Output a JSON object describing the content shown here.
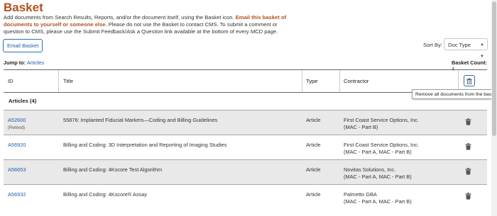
{
  "header": {
    "title": "Basket",
    "intro_part1": "Add documents from Search Results, Reports, and/or the document itself, using the Basket icon. ",
    "intro_emphasis": "Email this basket of documents to yourself or someone else.",
    "intro_part2": " Please do not use the Basket to contact CMS. To submit a comment or question to CMS, please use the Submit Feedback/Ask a Question link available at the bottom of every MCD page."
  },
  "toolbar": {
    "email_label": "Email Basket",
    "sort_label": "Sort By:",
    "sort_value": "Doc Type"
  },
  "jump": {
    "label": "Jump to:",
    "link": "Articles"
  },
  "count": {
    "label": "Basket Count:",
    "value": "4"
  },
  "table": {
    "headers": {
      "id": "ID",
      "title": "Title",
      "type": "Type",
      "contractor": "Contractor"
    },
    "group_label": "Articles (4)",
    "rows": [
      {
        "id": "A52600",
        "sub": "(Retired)",
        "title": "55876: Implanted Fiducial Markers—Coding and Billing Guidelines",
        "type": "Article",
        "contractor1": "First Coast Service Options, Inc.",
        "contractor2": "(MAC - Part B)"
      },
      {
        "id": "A56920",
        "sub": "",
        "title": "Billing and Coding: 3D Interpretation and Reporting of Imaging Studies",
        "type": "Article",
        "contractor1": "First Coast Service Options, Inc.",
        "contractor2": "(MAC - Part A, MAC - Part B)"
      },
      {
        "id": "A56653",
        "sub": "",
        "title": "Billing and Coding: 4Kscore Test Algorithm",
        "type": "Article",
        "contractor1": "Novitas Solutions, Inc.",
        "contractor2": "(MAC - Part A, MAC - Part B)"
      },
      {
        "id": "A56932",
        "sub": "",
        "title": "Billing and Coding: 4Kscore® Assay",
        "type": "Article",
        "contractor1": "Palmetto GBA",
        "contractor2": "(MAC - Part A, MAC - Part B)"
      }
    ]
  },
  "tooltip": {
    "text": "Remove all documents from the basket."
  },
  "icons": {
    "delete_all": "trash-icon",
    "delete_row": "trash-icon"
  },
  "colors": {
    "accent": "#b4501e",
    "link": "#1f5fa8",
    "row_alt": "#e9e9ea"
  }
}
